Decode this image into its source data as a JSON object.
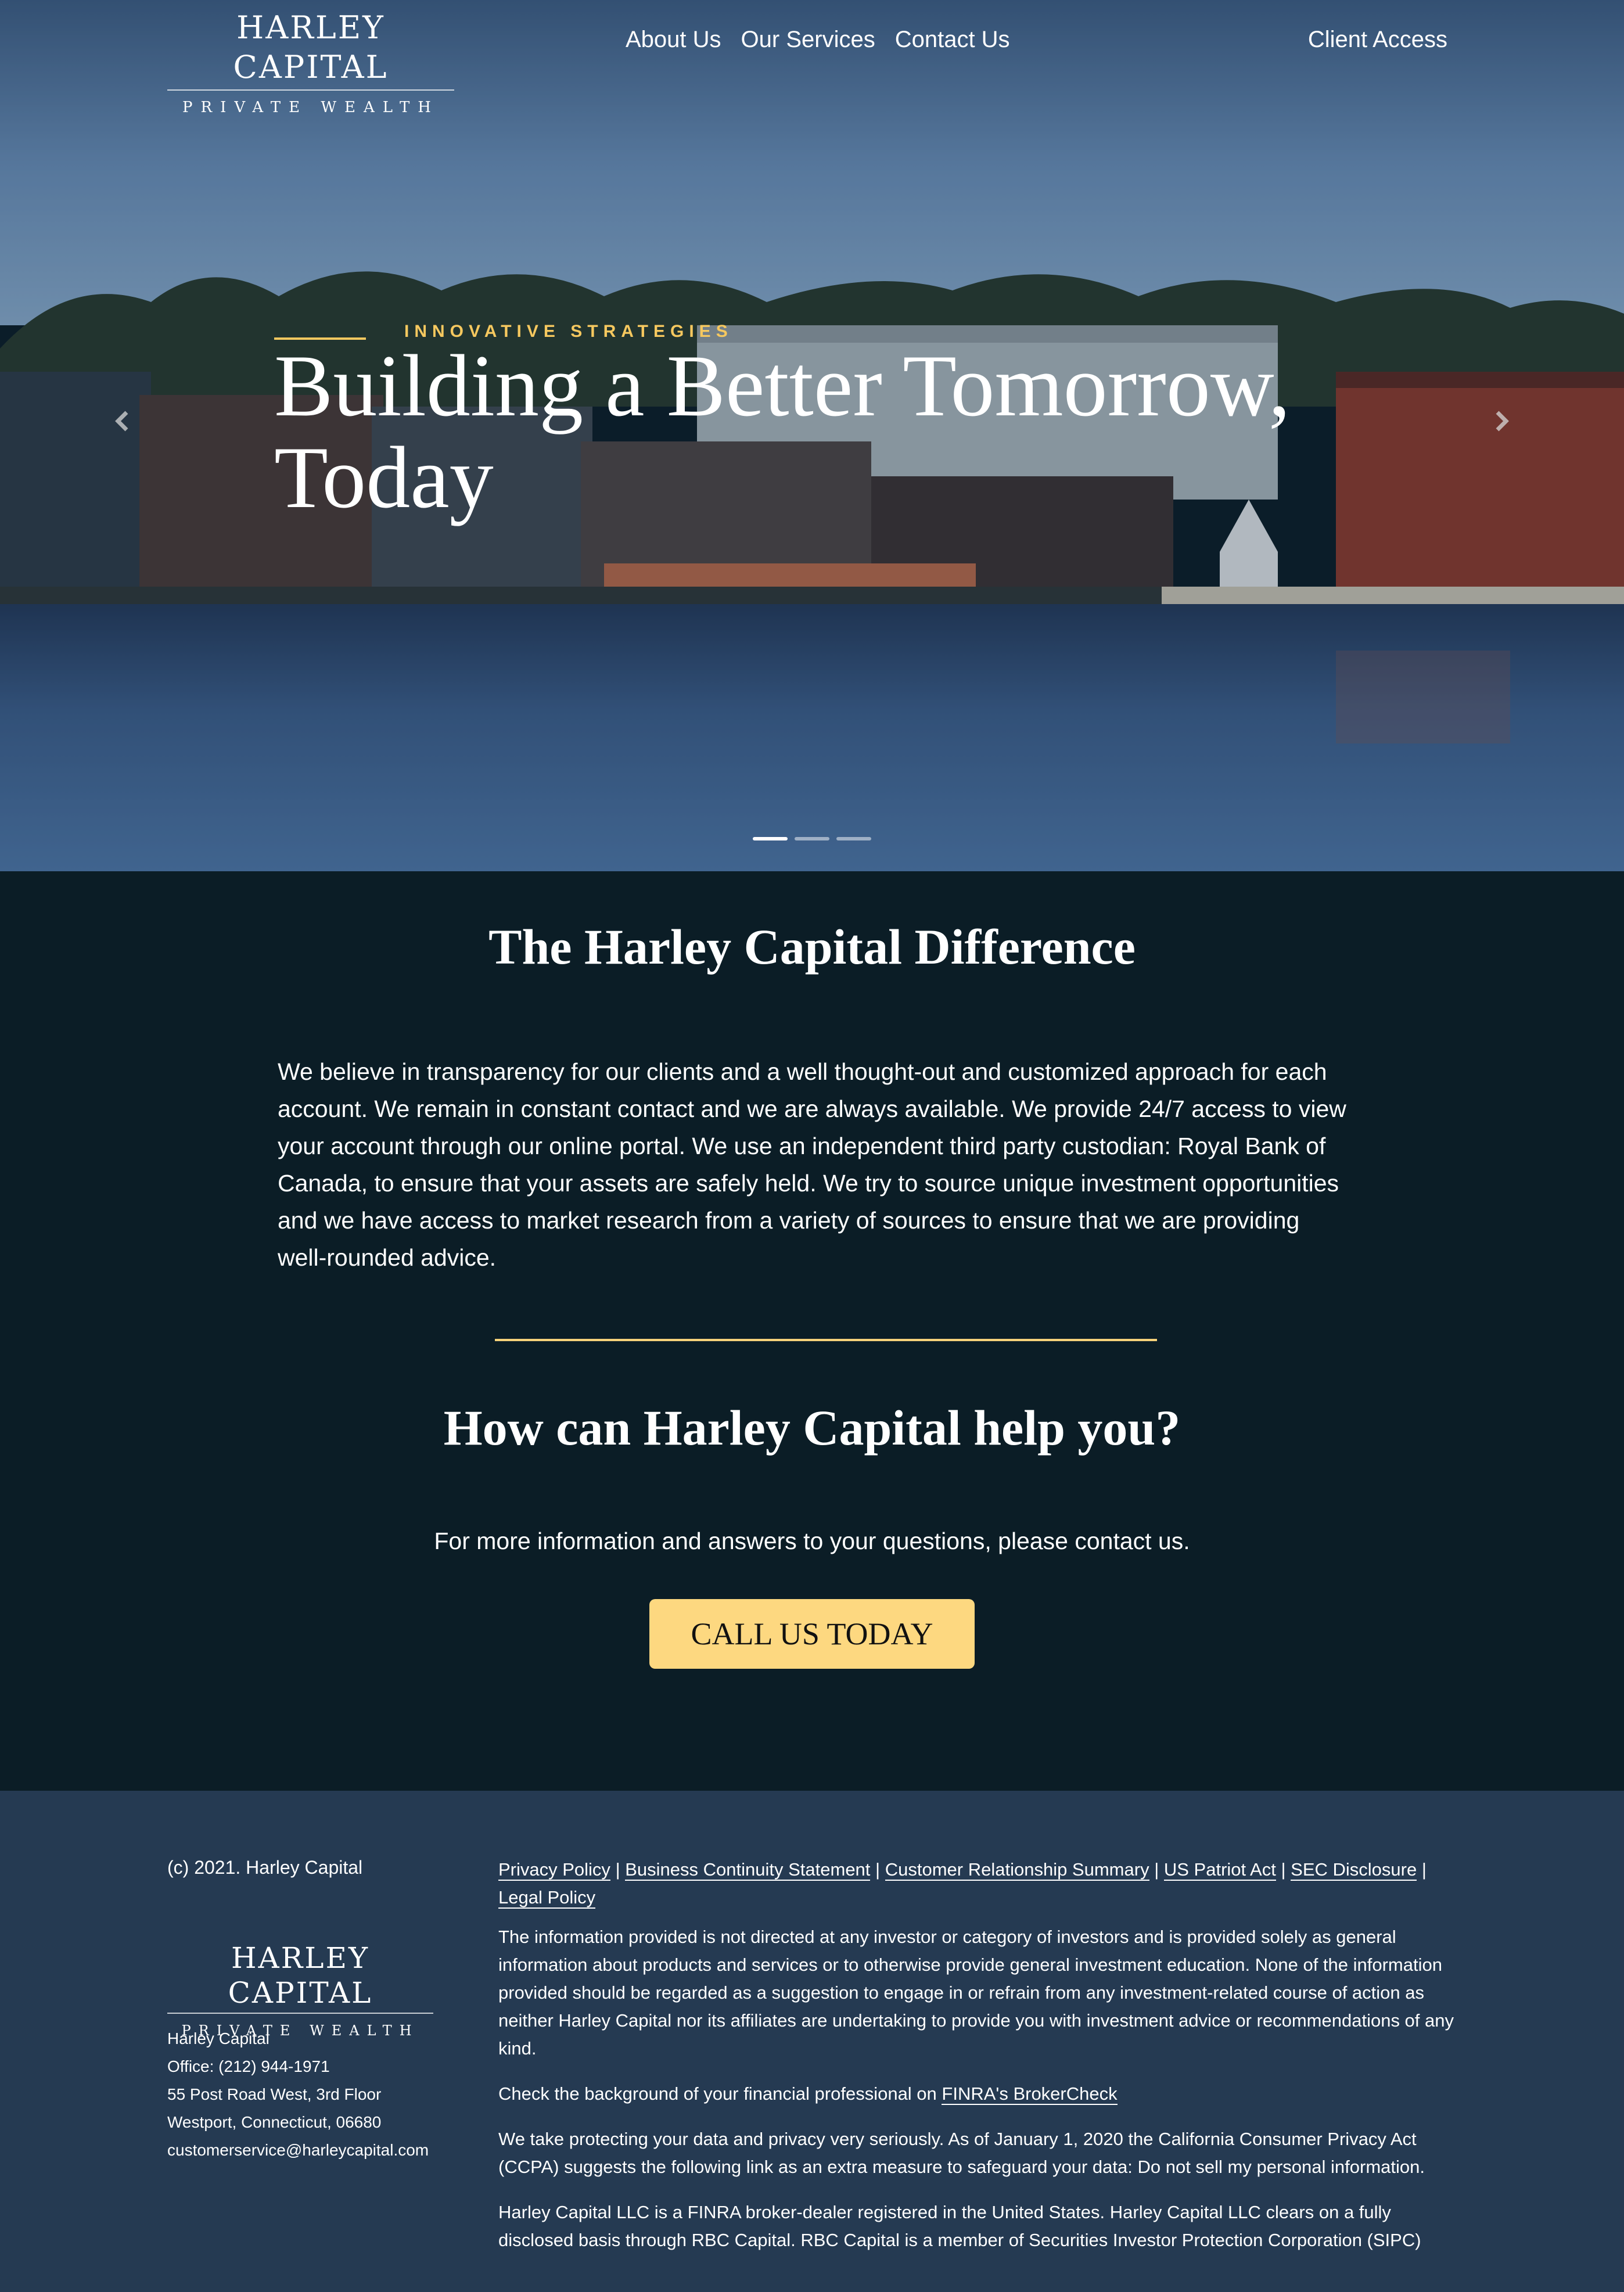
{
  "nav": {
    "logo_name": "HARLEY CAPITAL",
    "logo_tagline": "PRIVATE WEALTH",
    "links": [
      "About Us",
      "Our Services",
      "Contact Us"
    ],
    "client_access": "Client Access"
  },
  "hero": {
    "eyebrow": "INNOVATIVE STRATEGIES",
    "title_line1": "Building a Better Tomorrow,",
    "title_line2": "Today",
    "slides_total": 3,
    "active_slide": 1,
    "icons": {
      "prev": "chevron-left-icon",
      "next": "chevron-right-icon"
    }
  },
  "difference": {
    "title": "The Harley Capital Difference",
    "body": "We believe in transparency for our clients and a well thought-out and customized approach for each account. We remain in constant contact and we are always available. We provide 24/7 access to view your account through our online portal. We use an independent third party custodian: Royal Bank of Canada, to ensure that your assets are safely held. We try to source unique investment opportunities and we have access to market research from a variety of sources to ensure that we are providing well-rounded advice."
  },
  "help": {
    "title": "How can Harley Capital help you?",
    "body": "For more information and answers to your questions, please contact us.",
    "cta": "CALL US TODAY"
  },
  "footer": {
    "copyright": "(c) 2021. Harley Capital",
    "logo_name": "HARLEY CAPITAL",
    "logo_tagline": "PRIVATE WEALTH",
    "contact": {
      "name": "Harley Capital",
      "office": "Office: (212) 944-1971",
      "address1": "55 Post Road West, 3rd Floor",
      "address2": "Westport, Connecticut, 06680",
      "email": "customerservice@harleycapital.com"
    },
    "links": [
      "Privacy Policy",
      "Business Continuity Statement",
      "Customer Relationship Summary",
      "US Patriot Act",
      "SEC Disclosure",
      "Legal Policy"
    ],
    "separator": "|",
    "disclaimer": "The information provided is not directed at any investor or category of investors and is provided solely as general information about products and services or to otherwise provide general investment education. None of the information provided should be regarded as a suggestion to engage in or refrain from any investment-related course of action as neither Harley Capital nor its affiliates are undertaking to provide you with investment advice or recommendations of any kind.",
    "brokercheck_prefix": "Check the background of your financial professional on ",
    "brokercheck_link": "FINRA's BrokerCheck",
    "privacy": "We take protecting your data and privacy very seriously. As of January 1, 2020 the California Consumer Privacy Act (CCPA) suggests the following link as an extra measure to safeguard your data: Do not sell my personal information.",
    "finra": "Harley Capital LLC is a FINRA broker-dealer registered in the United States. Harley Capital LLC clears on a fully disclosed basis through RBC Capital. RBC Capital is a member of Securities Investor Protection Corporation (SIPC)"
  },
  "colors": {
    "accent_gold": "#f6c85f",
    "cta_bg": "#fdd880",
    "section_bg": "#0b1d26",
    "footer_bg": "#253a52"
  }
}
